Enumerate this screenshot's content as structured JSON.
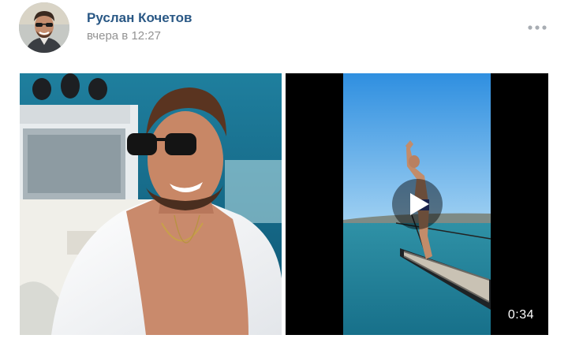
{
  "post": {
    "author_name": "Руслан Кочетов",
    "time": "вчера в 12:27"
  },
  "icons": {
    "more": "more-horizontal-icon",
    "play": "play-icon"
  },
  "colors": {
    "author_link": "#2a5885",
    "timestamp": "#939393",
    "menu_dots": "#a8adb3"
  },
  "media": {
    "video": {
      "duration": "0:34"
    }
  }
}
